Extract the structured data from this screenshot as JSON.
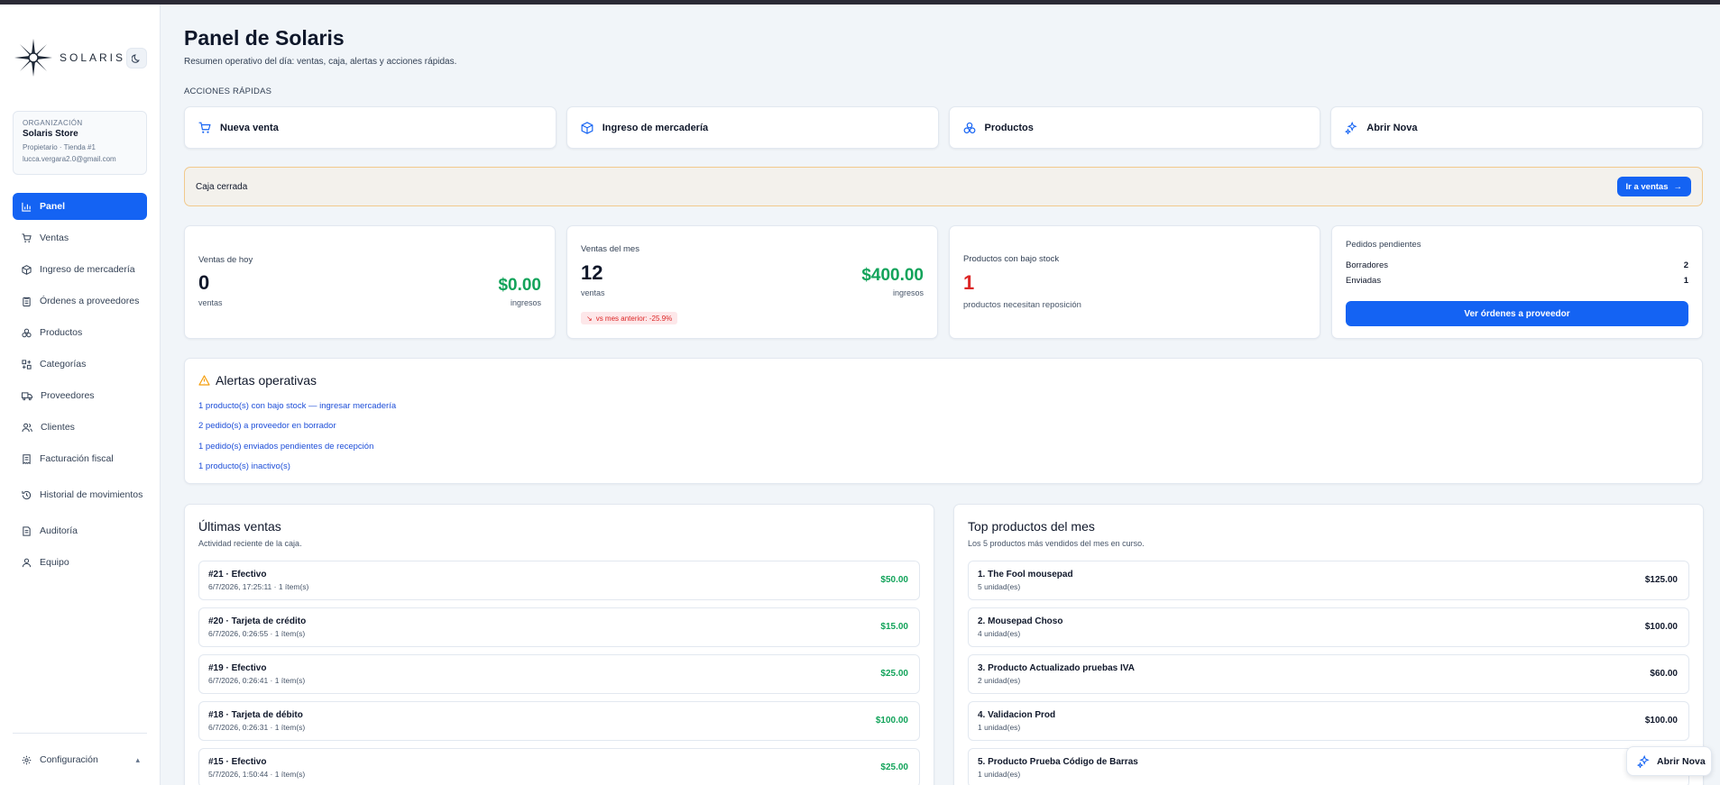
{
  "brand": {
    "name": "SOLARIS"
  },
  "organization": {
    "label": "ORGANIZACIÓN",
    "name": "Solaris Store",
    "role": "Propietario · Tienda #1",
    "email": "lucca.vergara2.0@gmail.com"
  },
  "nav": {
    "items": [
      {
        "label": "Panel",
        "icon": "bar-chart-icon"
      },
      {
        "label": "Ventas",
        "icon": "cart-icon"
      },
      {
        "label": "Ingreso de mercadería",
        "icon": "package-icon"
      },
      {
        "label": "Órdenes a proveedores",
        "icon": "clipboard-icon"
      },
      {
        "label": "Productos",
        "icon": "boxes-icon"
      },
      {
        "label": "Categorías",
        "icon": "shapes-icon"
      },
      {
        "label": "Proveedores",
        "icon": "truck-icon"
      },
      {
        "label": "Clientes",
        "icon": "users-icon"
      },
      {
        "label": "Facturación fiscal",
        "icon": "receipt-icon"
      },
      {
        "label": "Historial de movimientos",
        "icon": "history-icon"
      },
      {
        "label": "Auditoría",
        "icon": "audit-icon"
      },
      {
        "label": "Equipo",
        "icon": "user-group-icon"
      }
    ],
    "config_label": "Configuración"
  },
  "header": {
    "title": "Panel de Solaris",
    "subtitle": "Resumen operativo del día: ventas, caja, alertas y acciones rápidas."
  },
  "quick_actions": {
    "label": "ACCIONES RÁPIDAS",
    "items": [
      {
        "label": "Nueva venta",
        "icon": "cart-icon"
      },
      {
        "label": "Ingreso de mercadería",
        "icon": "package-icon"
      },
      {
        "label": "Productos",
        "icon": "boxes-icon"
      },
      {
        "label": "Abrir Nova",
        "icon": "sparkles-icon"
      }
    ]
  },
  "cash": {
    "status": "Caja cerrada",
    "button": "Ir a ventas"
  },
  "stats": {
    "today": {
      "label": "Ventas de hoy",
      "count": "0",
      "count_unit": "ventas",
      "amount": "$0.00",
      "amount_unit": "ingresos"
    },
    "month": {
      "label": "Ventas del mes",
      "count": "12",
      "count_unit": "ventas",
      "amount": "$400.00",
      "amount_unit": "ingresos",
      "trend": "vs mes anterior: -25.9%"
    },
    "low_stock": {
      "label": "Productos con bajo stock",
      "count": "1",
      "caption": "productos necesitan reposición"
    },
    "pending": {
      "label": "Pedidos pendientes",
      "rows": [
        {
          "label": "Borradores",
          "value": "2"
        },
        {
          "label": "Enviadas",
          "value": "1"
        }
      ],
      "button": "Ver órdenes a proveedor"
    }
  },
  "alerts": {
    "title": "Alertas operativas",
    "items": [
      "1 producto(s) con bajo stock — ingresar mercadería",
      "2 pedido(s) a proveedor en borrador",
      "1 pedido(s) enviados pendientes de recepción",
      "1 producto(s) inactivo(s)"
    ]
  },
  "recent_sales": {
    "title": "Últimas ventas",
    "subtitle": "Actividad reciente de la caja.",
    "rows": [
      {
        "title": "#21 · Efectivo",
        "meta": "6/7/2026, 17:25:11 · 1 ítem(s)",
        "amount": "$50.00"
      },
      {
        "title": "#20 · Tarjeta de crédito",
        "meta": "6/7/2026, 0:26:55 · 1 ítem(s)",
        "amount": "$15.00"
      },
      {
        "title": "#19 · Efectivo",
        "meta": "6/7/2026, 0:26:41 · 1 ítem(s)",
        "amount": "$25.00"
      },
      {
        "title": "#18 · Tarjeta de débito",
        "meta": "6/7/2026, 0:26:31 · 1 ítem(s)",
        "amount": "$100.00"
      },
      {
        "title": "#15 · Efectivo",
        "meta": "5/7/2026, 1:50:44 · 1 ítem(s)",
        "amount": "$25.00"
      }
    ]
  },
  "top_products": {
    "title": "Top productos del mes",
    "subtitle": "Los 5 productos más vendidos del mes en curso.",
    "rows": [
      {
        "title": "1. The Fool mousepad",
        "meta": "5 unidad(es)",
        "amount": "$125.00"
      },
      {
        "title": "2. Mousepad Choso",
        "meta": "4 unidad(es)",
        "amount": "$100.00"
      },
      {
        "title": "3. Producto Actualizado pruebas IVA",
        "meta": "2 unidad(es)",
        "amount": "$60.00"
      },
      {
        "title": "4. Validacion Prod",
        "meta": "1 unidad(es)",
        "amount": "$100.00"
      },
      {
        "title": "5. Producto Prueba Código de Barras",
        "meta": "1 unidad(es)",
        "amount": ""
      }
    ]
  },
  "nova_float": {
    "label": "Abrir Nova"
  },
  "colors": {
    "primary": "#1463f3",
    "success": "#12a35a",
    "danger": "#dc2626",
    "warning_border": "#f1c98c"
  }
}
